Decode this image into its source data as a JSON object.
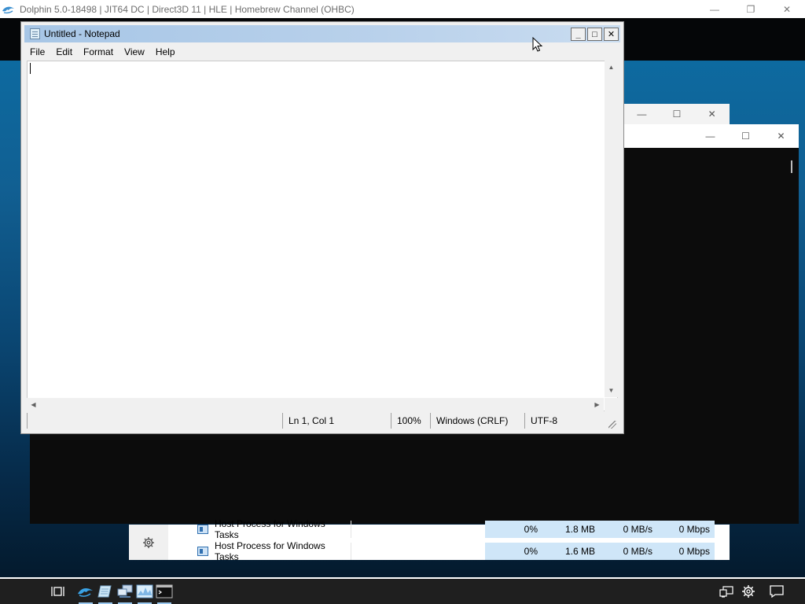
{
  "dolphin": {
    "title": "Dolphin 5.0-18498 | JIT64 DC | Direct3D 11 | HLE | Homebrew Channel (OHBC)",
    "controls": {
      "minimize": "—",
      "restore": "❐",
      "close": "✕"
    }
  },
  "background_windows": {
    "win1": {
      "minimize": "—",
      "maximize": "☐",
      "close": "✕"
    },
    "win2": {
      "minimize": "—",
      "maximize": "☐",
      "close": "✕"
    }
  },
  "notepad": {
    "title": "Untitled - Notepad",
    "menu": [
      "File",
      "Edit",
      "Format",
      "View",
      "Help"
    ],
    "text": "",
    "controls": {
      "minimize": "_",
      "maximize": "□",
      "close": "✕"
    },
    "status": {
      "position": "Ln 1, Col 1",
      "zoom": "100%",
      "line_ending": "Windows (CRLF)",
      "encoding": "UTF-8"
    }
  },
  "task_manager": {
    "rows": [
      {
        "name": "Host Process for Windows Tasks",
        "cpu": "0%",
        "memory": "1.8 MB",
        "disk": "0 MB/s",
        "network": "0 Mbps"
      },
      {
        "name": "Host Process for Windows Tasks",
        "cpu": "0%",
        "memory": "1.6 MB",
        "disk": "0 MB/s",
        "network": "0 Mbps"
      }
    ]
  },
  "taskbar": {
    "apps": [
      "task-view-icon",
      "dolphin-icon",
      "notepad-icon",
      "network-app-icon",
      "performance-icon",
      "terminal-icon"
    ],
    "tray": [
      "network-icon",
      "settings-icon",
      "notifications-icon"
    ]
  },
  "colors": {
    "accent": "#9ac8ef",
    "titlebar_active": "#b9d1eb",
    "selection": "#cfe6f8"
  }
}
